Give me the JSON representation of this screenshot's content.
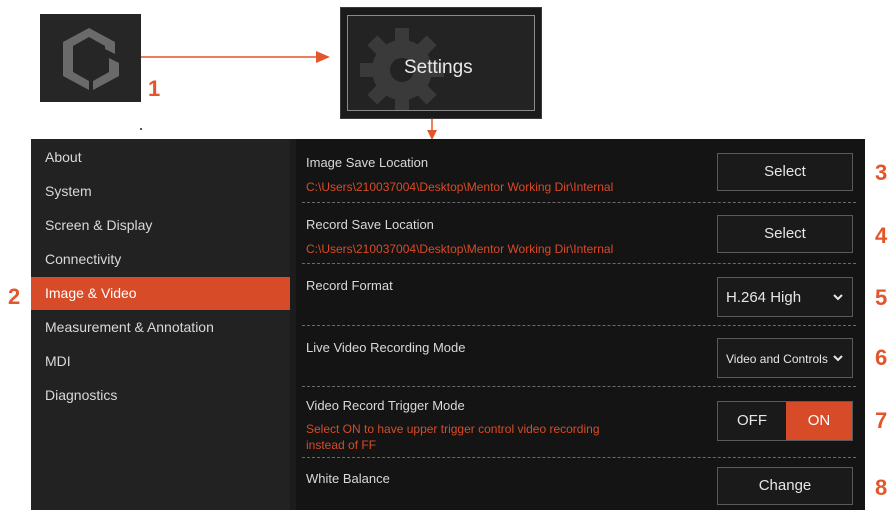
{
  "app_icon": "instrument-app-logo-icon",
  "settings_tile": {
    "label": "Settings",
    "icon": "gear-icon"
  },
  "callouts": [
    "1",
    "2",
    "3",
    "4",
    "5",
    "6",
    "7",
    "8"
  ],
  "colors": {
    "accent": "#d84b28",
    "panel": "#1c1c1c",
    "sidebar": "#222222",
    "content": "#141414"
  },
  "sidebar": {
    "items": [
      {
        "label": "About"
      },
      {
        "label": "System"
      },
      {
        "label": "Screen & Display"
      },
      {
        "label": "Connectivity"
      },
      {
        "label": "Image & Video",
        "active": true
      },
      {
        "label": "Measurement & Annotation"
      },
      {
        "label": "MDI"
      },
      {
        "label": "Diagnostics"
      }
    ]
  },
  "settings": {
    "image_save": {
      "title": "Image Save Location",
      "path": "C:\\Users\\210037004\\Desktop\\Mentor Working Dir\\Internal",
      "button": "Select"
    },
    "record_save": {
      "title": "Record Save Location",
      "path": "C:\\Users\\210037004\\Desktop\\Mentor Working Dir\\Internal",
      "button": "Select"
    },
    "record_format": {
      "title": "Record Format",
      "value": "H.264 High"
    },
    "live_mode": {
      "title": "Live Video Recording Mode",
      "value": "Video and Controls"
    },
    "trigger_mode": {
      "title": "Video Record Trigger Mode",
      "hint_line1": "Select ON to have upper trigger control video recording",
      "hint_line2": "instead of FF",
      "off_label": "OFF",
      "on_label": "ON",
      "selected": "ON"
    },
    "white_balance": {
      "title": "White Balance",
      "button": "Change"
    }
  }
}
